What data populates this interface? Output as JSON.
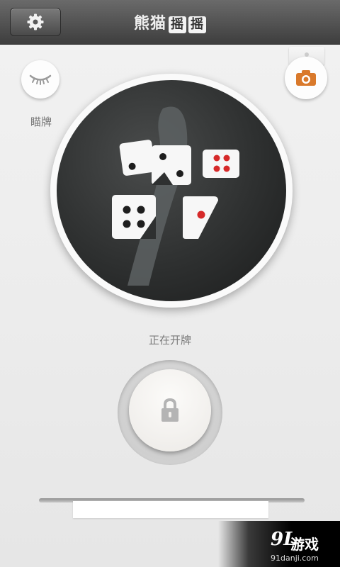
{
  "header": {
    "title_main": "熊猫",
    "title_box_1": "摇",
    "title_box_2": "摇"
  },
  "icons": {
    "settings": "gear-icon",
    "peek": "eye-closed-icon",
    "camera": "camera-icon",
    "lock": "lock-icon"
  },
  "peek": {
    "label": "瞄牌"
  },
  "status": {
    "label": "正在开牌"
  },
  "watermark": {
    "logo": "9L",
    "text": "游戏",
    "url": "91danji.com"
  },
  "colors": {
    "camera_accent": "#d9792b",
    "pip_red": "#d62a2a",
    "pip_black": "#1e1e1e"
  }
}
